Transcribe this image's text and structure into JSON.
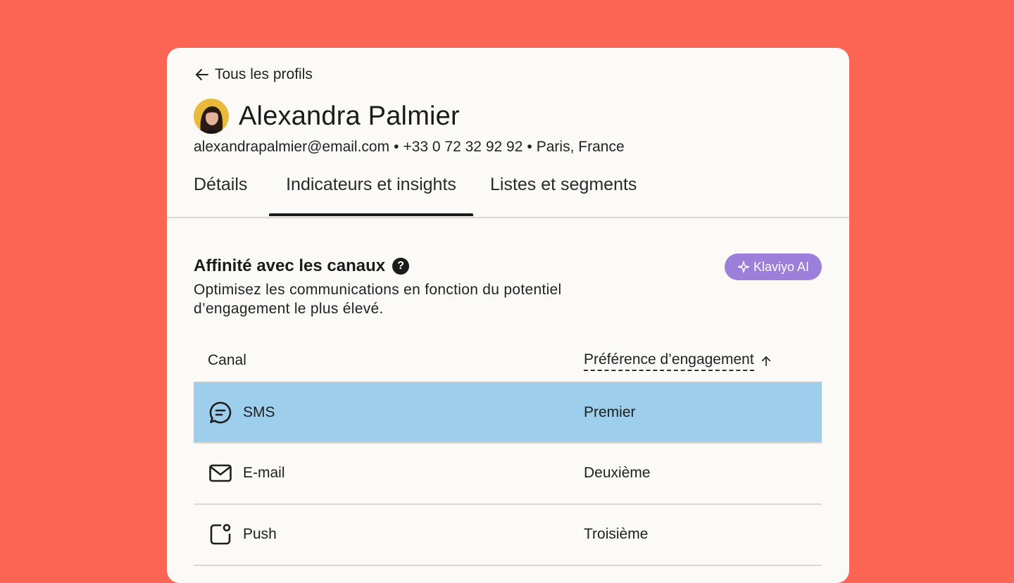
{
  "back_link": {
    "label": "Tous les profils"
  },
  "profile": {
    "name": "Alexandra Palmier",
    "email": "alexandrapalmier@email.com",
    "phone": "+33 0 72 32 92 92",
    "location": "Paris, France",
    "separator": "•"
  },
  "tabs": [
    {
      "label": "Détails",
      "active": false
    },
    {
      "label": "Indicateurs et insights",
      "active": true
    },
    {
      "label": "Listes et segments",
      "active": false
    }
  ],
  "section": {
    "title": "Affinité avec les canaux",
    "help_icon_glyph": "?",
    "badge": "Klaviyo AI",
    "description": "Optimisez les communications en fonction du potentiel d’engagement le plus élevé."
  },
  "table": {
    "columns": {
      "channel": "Canal",
      "preference": "Préférence d’engagement"
    },
    "rows": [
      {
        "icon": "sms-chat-icon",
        "channel": "SMS",
        "preference": "Premier",
        "highlighted": true
      },
      {
        "icon": "mail-icon",
        "channel": "E-mail",
        "preference": "Deuxième",
        "highlighted": false
      },
      {
        "icon": "push-notification-icon",
        "channel": "Push",
        "preference": "Troisième",
        "highlighted": false
      }
    ]
  },
  "colors": {
    "background": "#FC6454",
    "card": "#FCFAF6",
    "highlight_row": "#9DCFED",
    "ai_badge": "#9B7FDA"
  }
}
